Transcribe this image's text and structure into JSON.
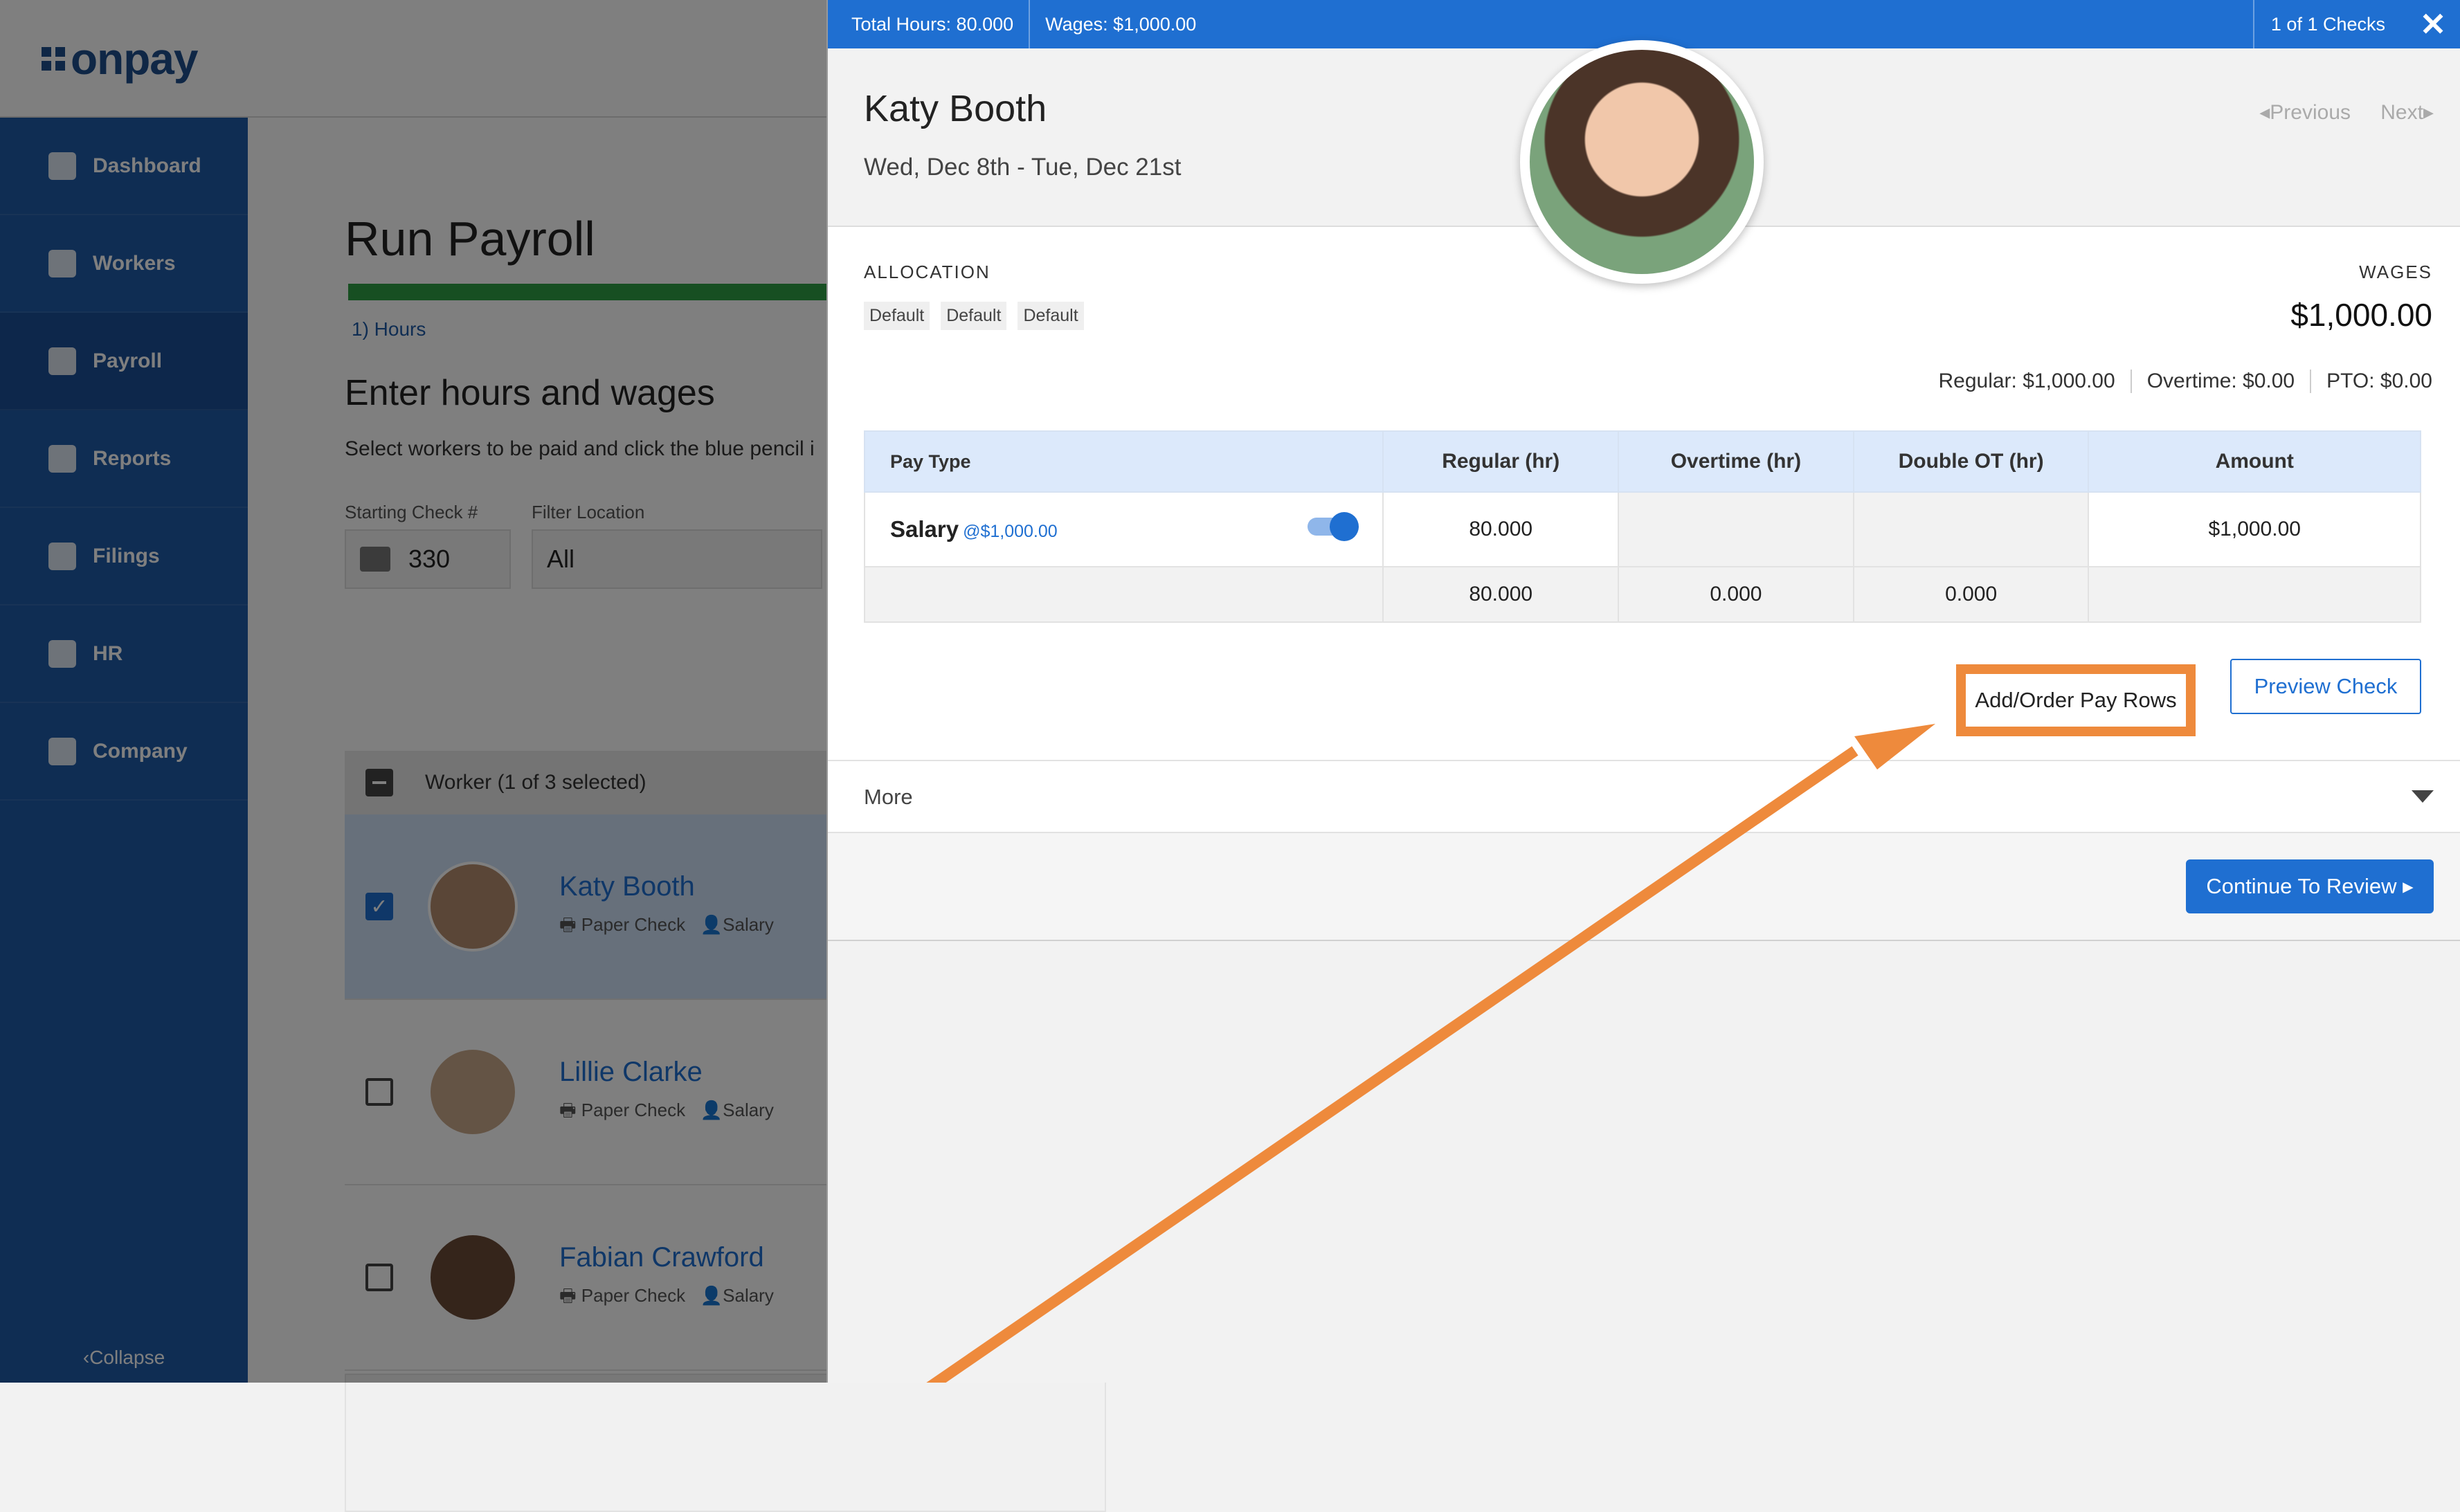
{
  "app": {
    "logo_text": "onpay",
    "brand_color": "#1f5aa6"
  },
  "sidebar": {
    "items": [
      {
        "label": "Dashboard",
        "icon": "dashboard-icon"
      },
      {
        "label": "Workers",
        "icon": "workers-icon"
      },
      {
        "label": "Payroll",
        "icon": "payroll-icon"
      },
      {
        "label": "Reports",
        "icon": "reports-icon"
      },
      {
        "label": "Filings",
        "icon": "filings-icon"
      },
      {
        "label": "HR",
        "icon": "hr-icon"
      },
      {
        "label": "Company",
        "icon": "company-icon"
      }
    ],
    "collapse": "Collapse"
  },
  "main": {
    "title": "Run Payroll",
    "step": "1) Hours",
    "section_title": "Enter hours and wages",
    "hint": "Select workers to be paid and click the blue pencil i",
    "starting_check_label": "Starting Check #",
    "starting_check_value": "330",
    "filter_label": "Filter Location",
    "filter_value": "All",
    "worker_header": "Worker (1 of 3 selected)",
    "workers": [
      {
        "name": "Katy Booth",
        "method": "Paper Check",
        "type": "Salary",
        "selected": true
      },
      {
        "name": "Lillie Clarke",
        "method": "Paper Check",
        "type": "Salary",
        "selected": false
      },
      {
        "name": "Fabian Crawford",
        "method": "Paper Check",
        "type": "Salary",
        "selected": false
      }
    ]
  },
  "panel": {
    "total_hours": "Total Hours: 80.000",
    "wages": "Wages: $1,000.00",
    "checks": "1 of 1 Checks",
    "close": "✕",
    "employee_name": "Katy Booth",
    "dates": "Wed, Dec 8th - Tue, Dec 21st",
    "previous": "Previous",
    "next": "Next",
    "allocation_label": "ALLOCATION",
    "allocation_tags": [
      "Default",
      "Default",
      "Default"
    ],
    "wages_label": "WAGES",
    "wages_value": "$1,000.00",
    "summary": {
      "regular": "Regular: $1,000.00",
      "overtime": "Overtime: $0.00",
      "pto": "PTO: $0.00"
    },
    "table": {
      "headers": [
        "Pay Type",
        "Regular (hr)",
        "Overtime (hr)",
        "Double OT (hr)",
        "Amount"
      ],
      "row": {
        "pay_type": "Salary",
        "rate": "@$1,000.00",
        "toggle_on": true,
        "regular": "80.000",
        "overtime": "",
        "double_ot": "",
        "amount": "$1,000.00"
      },
      "totals": {
        "regular": "80.000",
        "overtime": "0.000",
        "double_ot": "0.000"
      }
    },
    "add_order_button": "Add/Order Pay Rows",
    "preview_button": "Preview Check",
    "more_label": "More",
    "continue_button": "Continue To Review"
  },
  "annotation": {
    "highlight_color": "#ee8a3c"
  }
}
